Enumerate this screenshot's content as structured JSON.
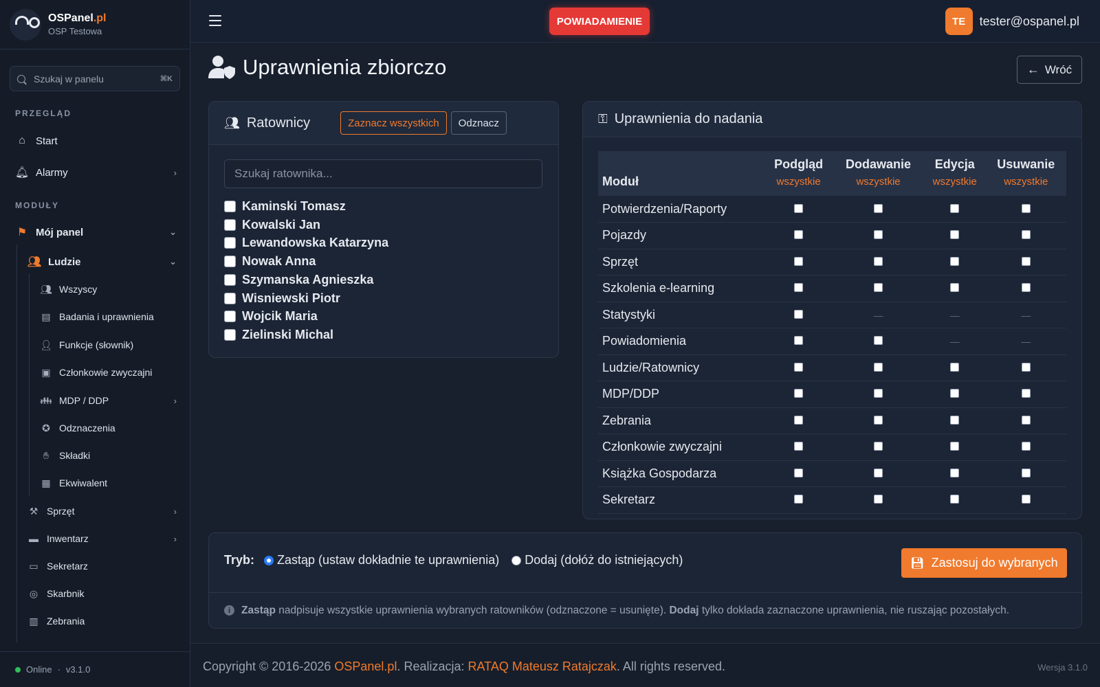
{
  "brand": {
    "name": "OSPanel",
    "name_suffix": ".pl",
    "unit": "OSP Testowa"
  },
  "search": {
    "placeholder": "Szukaj w panelu",
    "shortcut": "⌘K"
  },
  "sidebar": {
    "section_overview": "PRZEGLĄD",
    "start": "Start",
    "alarms": "Alarmy",
    "section_modules": "MODUŁY",
    "my_panel": "Mój panel",
    "people": "Ludzie",
    "people_items": [
      {
        "label": "Wszyscy",
        "icon": "users-icon"
      },
      {
        "label": "Badania i uprawnienia",
        "icon": "file-medical-icon"
      },
      {
        "label": "Funkcje (słownik)",
        "icon": "user-tag-icon"
      },
      {
        "label": "Członkowie zwyczajni",
        "icon": "id-card-icon"
      },
      {
        "label": "MDP / DDP",
        "icon": "children-icon"
      },
      {
        "label": "Odznaczenia",
        "icon": "medal-icon"
      },
      {
        "label": "Składki",
        "icon": "hand-coin-icon"
      },
      {
        "label": "Ekwiwalent",
        "icon": "calculator-icon"
      }
    ],
    "modules": [
      {
        "label": "Sprzęt",
        "icon": "tools-icon"
      },
      {
        "label": "Inwentarz",
        "icon": "book-icon"
      },
      {
        "label": "Sekretarz",
        "icon": "folder-icon"
      },
      {
        "label": "Skarbnik",
        "icon": "coins-icon"
      },
      {
        "label": "Zebrania",
        "icon": "calendar-icon"
      }
    ],
    "status": "Online",
    "version": "v3.1.0"
  },
  "topbar": {
    "notification": "POWIADAMIENIE",
    "avatar_initials": "TE",
    "user_email": "tester@ospanel.pl"
  },
  "page": {
    "title": "Uprawnienia zbiorczo",
    "back": "Wróć"
  },
  "rescuers": {
    "title": "Ratownicy",
    "select_all": "Zaznacz wszystkich",
    "deselect": "Odznacz",
    "search_placeholder": "Szukaj ratownika...",
    "people": [
      "Kaminski Tomasz",
      "Kowalski Jan",
      "Lewandowska Katarzyna",
      "Nowak Anna",
      "Szymanska Agnieszka",
      "Wisniewski Piotr",
      "Wojcik Maria",
      "Zielinski Michal"
    ]
  },
  "permissions": {
    "title": "Uprawnienia do nadania",
    "module_header": "Moduł",
    "all_label": "wszystkie",
    "columns": [
      "Podgląd",
      "Dodawanie",
      "Edycja",
      "Usuwanie"
    ],
    "rows": [
      {
        "module": "Potwierdzenia/Raporty",
        "cells": [
          true,
          true,
          true,
          true
        ]
      },
      {
        "module": "Pojazdy",
        "cells": [
          true,
          true,
          true,
          true
        ]
      },
      {
        "module": "Sprzęt",
        "cells": [
          true,
          true,
          true,
          true
        ]
      },
      {
        "module": "Szkolenia e-learning",
        "cells": [
          true,
          true,
          true,
          true
        ]
      },
      {
        "module": "Statystyki",
        "cells": [
          true,
          false,
          false,
          false
        ]
      },
      {
        "module": "Powiadomienia",
        "cells": [
          true,
          true,
          false,
          false
        ]
      },
      {
        "module": "Ludzie/Ratownicy",
        "cells": [
          true,
          true,
          true,
          true
        ]
      },
      {
        "module": "MDP/DDP",
        "cells": [
          true,
          true,
          true,
          true
        ]
      },
      {
        "module": "Zebrania",
        "cells": [
          true,
          true,
          true,
          true
        ]
      },
      {
        "module": "Członkowie zwyczajni",
        "cells": [
          true,
          true,
          true,
          true
        ]
      },
      {
        "module": "Książka Gospodarza",
        "cells": [
          true,
          true,
          true,
          true
        ]
      },
      {
        "module": "Sekretarz",
        "cells": [
          true,
          true,
          true,
          true
        ]
      }
    ],
    "unavailable": "—"
  },
  "mode": {
    "label": "Tryb:",
    "replace": "Zastąp (ustaw dokładnie te uprawnienia)",
    "add": "Dodaj (dołóż do istniejących)",
    "apply": "Zastosuj do wybranych",
    "info_replace_bold": "Zastąp",
    "info_replace": " nadpisuje wszystkie uprawnienia wybranych ratowników (odznaczone = usunięte). ",
    "info_add_bold": "Dodaj",
    "info_add": " tylko dokłada zaznaczone uprawnienia, nie ruszając pozostałych."
  },
  "footer": {
    "copyright": "Copyright © 2016-2026 ",
    "brand": "OSPanel.pl",
    "realization": ". Realizacja: ",
    "author": "RATAQ Mateusz Ratajczak",
    "rights": ". All rights reserved.",
    "version": "Wersja 3.1.0"
  },
  "colors": {
    "accent": "#f07a2d",
    "danger": "#e53935",
    "background": "#18202e",
    "online": "#2fbf5a"
  }
}
